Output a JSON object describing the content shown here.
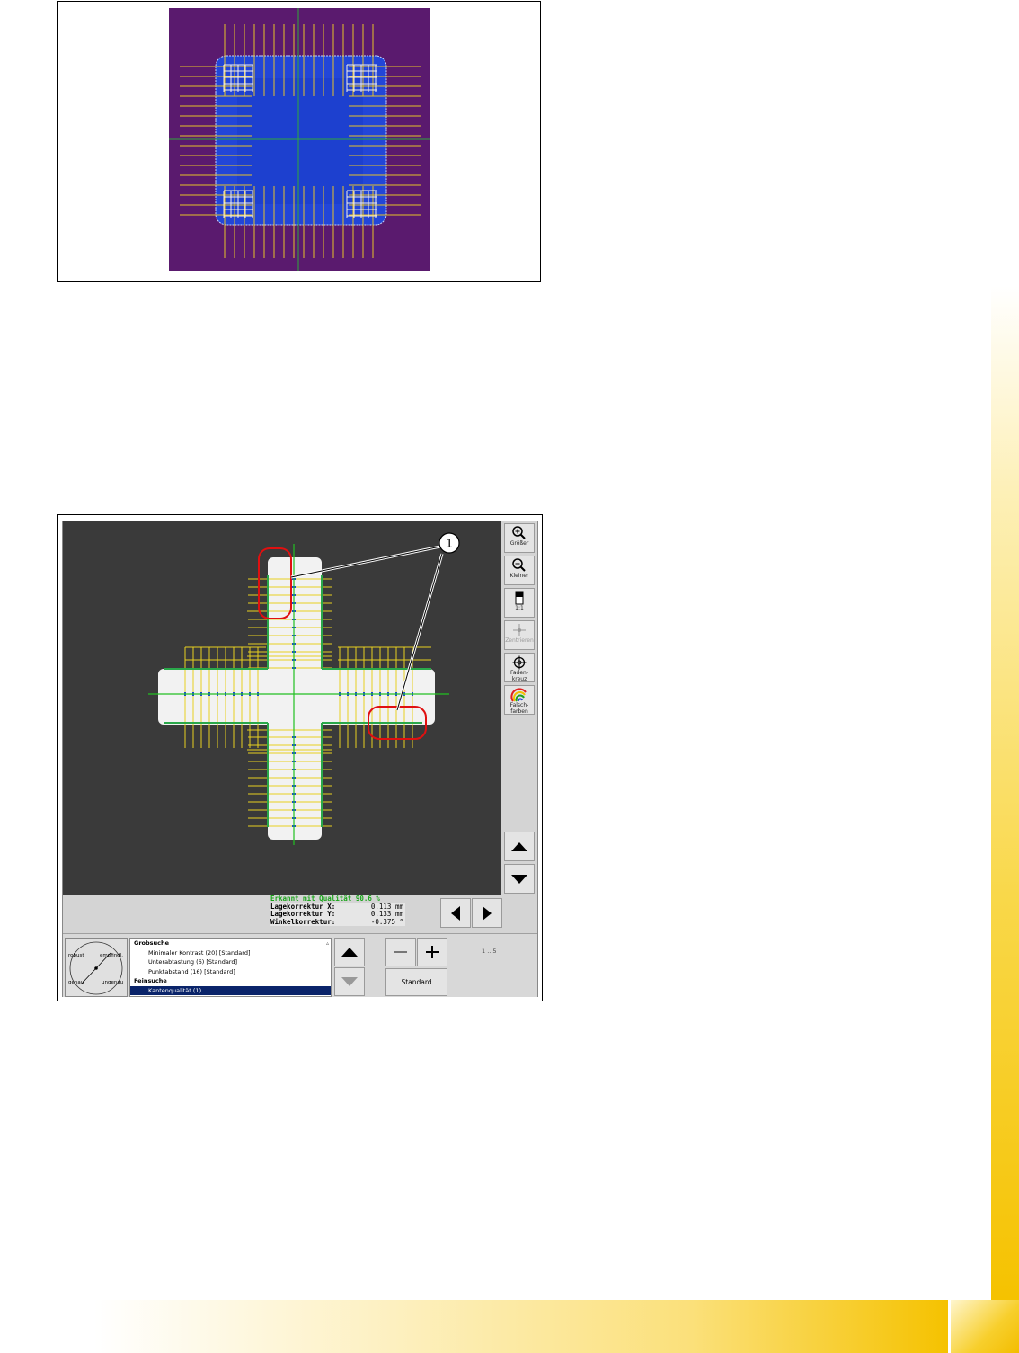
{
  "figure1": {
    "colors": {
      "background": "#5a1a6e",
      "object": "#2244dd",
      "grid_lines": "#e6c228",
      "crosshair": "#2ea83a"
    }
  },
  "figure2": {
    "callout_number": "1",
    "toolbar": [
      {
        "name": "zoom-in-button",
        "icon": "zoom-in-icon",
        "label": "Größer",
        "enabled": true
      },
      {
        "name": "zoom-out-button",
        "icon": "zoom-out-icon",
        "label": "Kleiner",
        "enabled": true
      },
      {
        "name": "scale-1-1-button",
        "icon": "scale-icon",
        "label": "1:1",
        "enabled": true
      },
      {
        "name": "center-button",
        "icon": "center-icon",
        "label": "Zentrieren",
        "enabled": false
      },
      {
        "name": "crosshair-button",
        "icon": "crosshair-icon",
        "label": "Faden-\nkreuz",
        "enabled": true
      },
      {
        "name": "false-colors-button",
        "icon": "rainbow-icon",
        "label": "Falsch-\nfarben",
        "enabled": true
      }
    ],
    "status": {
      "quality_text": "Erkannt mit Qualität  90.6 %",
      "rows": [
        {
          "label": "Lagekorrektur X:",
          "value": "0.113 mm"
        },
        {
          "label": "Lagekorrektur Y:",
          "value": "0.133 mm"
        },
        {
          "label": "Winkelkorrektur:",
          "value": "-0.375 °"
        }
      ]
    },
    "dial": {
      "top_left": "robust",
      "top_right": "empfindl.",
      "bottom_left": "genau",
      "bottom_right": "ungenau"
    },
    "params": [
      {
        "type": "group",
        "text": "Grobsuche"
      },
      {
        "type": "item",
        "text": "Minimaler Kontrast (20) [Standard]",
        "selected": false
      },
      {
        "type": "item",
        "text": "Unterabtastung (6) [Standard]",
        "selected": false
      },
      {
        "type": "item",
        "text": "Punktabstand (16) [Standard]",
        "selected": false
      },
      {
        "type": "group",
        "text": "Feinsuche"
      },
      {
        "type": "item",
        "text": "Kantenqualität (1)",
        "selected": true
      }
    ],
    "range_label": "1 .. 5",
    "standard_button": "Standard",
    "colors": {
      "view_background": "#3a3a3a",
      "object": "#f2f2f2",
      "grid_lines": "#e8d020",
      "crosshair": "#22c022",
      "edge_points": "#2aa84a",
      "highlight": "#e01010",
      "selected_item": "#0a246a"
    }
  }
}
